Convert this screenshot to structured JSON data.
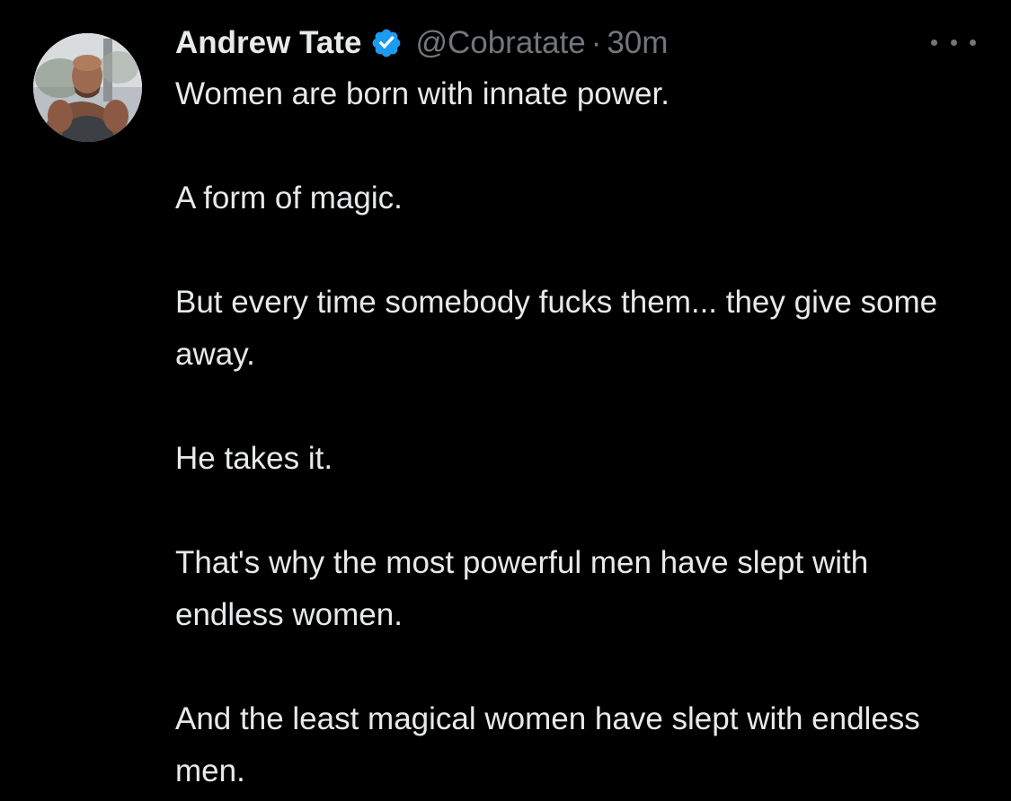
{
  "tweet": {
    "author": {
      "display_name": "Andrew Tate",
      "handle": "@Cobratate",
      "verified": true,
      "avatar_icon": "profile-photo"
    },
    "separator": "·",
    "time": "30m",
    "more_icon": "ellipsis-icon",
    "text": "Women are born with innate power.\n\nA form of magic.\n\nBut every time somebody fucks them... they give some away.\n\nHe takes it.\n\nThat's why the most powerful men have slept with endless women.\n\nAnd the least magical women have slept with endless men."
  },
  "colors": {
    "background": "#000000",
    "text_primary": "#e7e9ea",
    "text_secondary": "#71767b",
    "verified_badge": "#1d9bf0"
  }
}
